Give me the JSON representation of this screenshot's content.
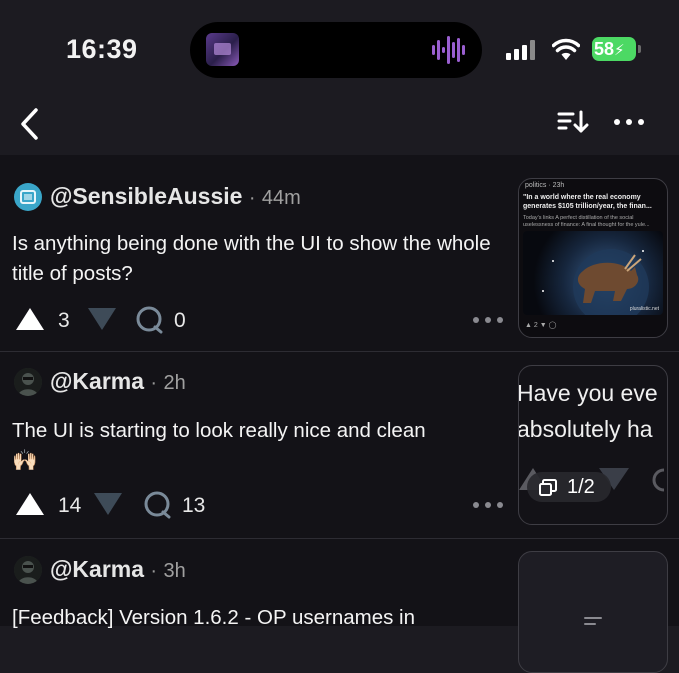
{
  "status_bar": {
    "time": "16:39",
    "battery": "58"
  },
  "posts": [
    {
      "author": "@SensibleAussie",
      "age": "44m",
      "title": "Is anything being done with the UI to show the whole title of posts?",
      "upvotes": "3",
      "comments": "0",
      "thumbnail": {
        "category": "politics · 23h",
        "headline": "\"In a world where the real economy generates $105 trillion/year, the finan...",
        "body": "Today's links A perfect distillation of the social uselessness of finance: A final thought for the yule...",
        "source": "pluralistic.net",
        "votes": "2"
      }
    },
    {
      "author": "@Karma",
      "age": "2h",
      "title": "The UI is starting to look really nice and clean",
      "emoji": "🙌🏻",
      "upvotes": "14",
      "comments": "13",
      "thumbnail": {
        "line1": "Have you eve",
        "line2": "absolutely ha",
        "image_count": "1/2"
      }
    },
    {
      "author": "@Karma",
      "age": "3h",
      "title": "[Feedback] Version 1.6.2 - OP usernames in"
    }
  ]
}
